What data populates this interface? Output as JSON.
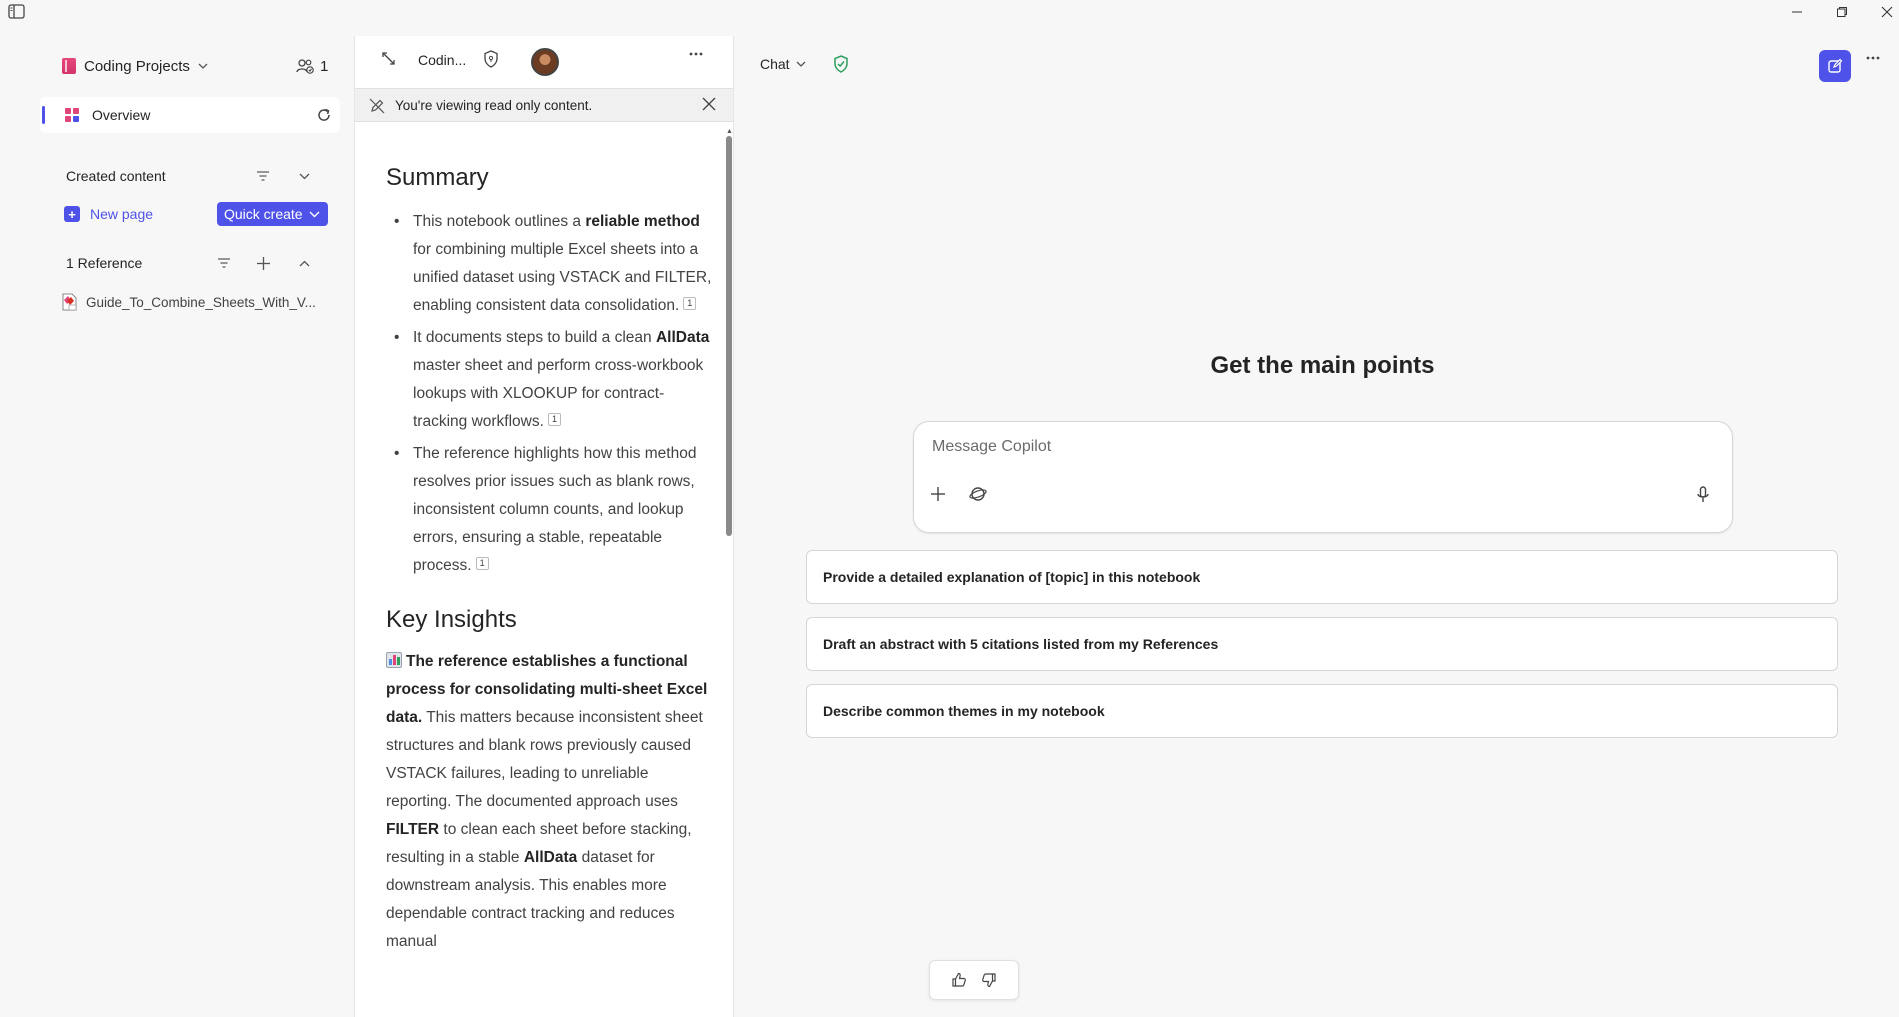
{
  "notebook": {
    "title": "Coding Projects",
    "share_count": "1"
  },
  "nav": {
    "overview_label": "Overview",
    "created_content_title": "Created content",
    "new_page_label": "New page",
    "quick_create_label": "Quick create",
    "references_title": "1 Reference",
    "reference_items": [
      "Guide_To_Combine_Sheets_With_V..."
    ]
  },
  "page": {
    "title": "Codin...",
    "readonly_message": "You're viewing read only content.",
    "summary_heading": "Summary",
    "summary_items": [
      {
        "t1": "This notebook outlines a ",
        "b1": "reliable method",
        "t2": " for combining multiple Excel sheets into a unified dataset using VSTACK and FILTER, enabling consistent data consolidation.",
        "cite": "1"
      },
      {
        "t1": "It documents steps to build a clean ",
        "b1": "AllData",
        "t2": " master sheet and perform cross-workbook lookups with XLOOKUP for contract-tracking workflows.",
        "cite": "1"
      },
      {
        "t1": "The reference highlights how this method resolves prior issues such as blank rows, inconsistent column counts, and lookup errors, ensuring a stable, repeatable process.",
        "b1": "",
        "t2": "",
        "cite": "1"
      }
    ],
    "insights_heading": "Key Insights",
    "insight_bold": "The reference establishes a functional process for consolidating multi-sheet Excel data.",
    "insight_t1": " This matters because inconsistent sheet structures and blank rows previously caused VSTACK failures, leading to unreliable reporting. The documented approach uses ",
    "insight_b2": "FILTER",
    "insight_t2": " to clean each sheet before stacking, resulting in a stable ",
    "insight_b3": "AllData",
    "insight_t3": " dataset for downstream analysis. This enables more dependable contract tracking and reduces manual"
  },
  "chat": {
    "mode_label": "Chat",
    "heading": "Get the main points",
    "input_placeholder": "Message Copilot",
    "suggestions": [
      "Provide a detailed explanation of [topic] in this notebook",
      "Draft an abstract with 5 citations listed from my References",
      "Describe common themes in my notebook"
    ]
  },
  "colors": {
    "accent": "#4f52e8",
    "notebook_icon": "#e0457a",
    "shield_green": "#2e9e5b"
  },
  "icons": [
    "sidebar-toggle-icon",
    "minimize-icon",
    "restore-icon",
    "close-icon",
    "notebook-icon",
    "chevron-down-icon",
    "people-icon",
    "grid-icon",
    "refresh-icon",
    "filter-icon",
    "plus-icon",
    "chevron-up-icon",
    "pdf-icon",
    "expand-icon",
    "shield-icon",
    "avatar",
    "more-icon",
    "pencil-off-icon",
    "compose-icon",
    "globe-icon",
    "mic-icon",
    "thumbs-up-icon",
    "thumbs-down-icon"
  ]
}
